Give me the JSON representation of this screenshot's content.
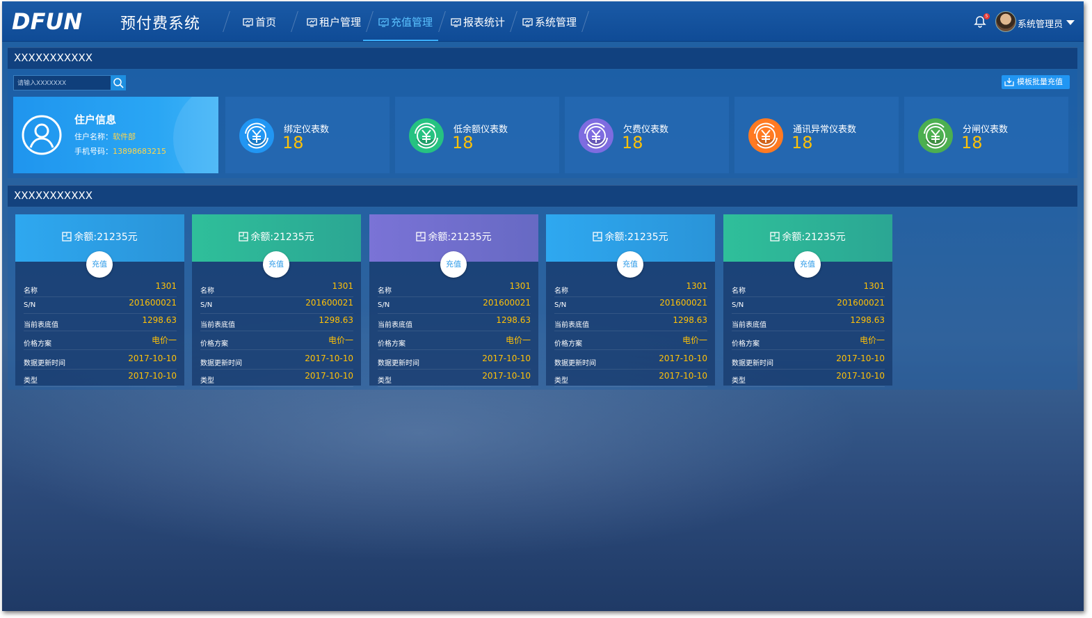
{
  "header": {
    "logo_text": "DFUN",
    "system_title": "预付费系统",
    "nav": [
      {
        "label": "首页"
      },
      {
        "label": "租户管理"
      },
      {
        "label": "充值管理"
      },
      {
        "label": "报表统计"
      },
      {
        "label": "系统管理"
      }
    ],
    "active_nav": "充值管理",
    "notification_count": "5",
    "user_name": "系统管理员"
  },
  "section1": {
    "title": "XXXXXXXXXXX",
    "search_placeholder": "请输入XXXXXXX",
    "batch_button": "模板批量充值",
    "tenant": {
      "title": "住户信息",
      "name_label": "住户名称：",
      "name_value": "软件部",
      "phone_label": "手机号码：",
      "phone_value": "13898683215"
    },
    "stats": [
      {
        "label": "绑定仪表数",
        "value": "18",
        "color": "#2196f3"
      },
      {
        "label": "低余额仪表数",
        "value": "18",
        "color": "#26c281"
      },
      {
        "label": "欠费仪表数",
        "value": "18",
        "color": "#7e6ce0"
      },
      {
        "label": "通讯异常仪表数",
        "value": "18",
        "color": "#ff7a22"
      },
      {
        "label": "分闸仪表数",
        "value": "18",
        "color": "#4caf50"
      }
    ]
  },
  "section2": {
    "title": "XXXXXXXXXXX",
    "meters": [
      {
        "balance": "余额:21235元",
        "recharge": "充值",
        "head_color": "#2ea8f0",
        "rows": [
          [
            "名称",
            "1301"
          ],
          [
            "S/N",
            "201600021"
          ],
          [
            "当前表底值",
            "1298.63"
          ],
          [
            "价格方案",
            "电价一"
          ],
          [
            "数据更新时间",
            "2017-10-10"
          ],
          [
            "类型",
            "2017-10-10"
          ]
        ]
      },
      {
        "balance": "余额:21235元",
        "recharge": "充值",
        "head_color": "#2fbf9a",
        "rows": [
          [
            "名称",
            "1301"
          ],
          [
            "S/N",
            "201600021"
          ],
          [
            "当前表底值",
            "1298.63"
          ],
          [
            "价格方案",
            "电价一"
          ],
          [
            "数据更新时间",
            "2017-10-10"
          ],
          [
            "类型",
            "2017-10-10"
          ]
        ]
      },
      {
        "balance": "余额:21235元",
        "recharge": "充值",
        "head_color": "#7a73d6",
        "rows": [
          [
            "名称",
            "1301"
          ],
          [
            "S/N",
            "201600021"
          ],
          [
            "当前表底值",
            "1298.63"
          ],
          [
            "价格方案",
            "电价一"
          ],
          [
            "数据更新时间",
            "2017-10-10"
          ],
          [
            "类型",
            "2017-10-10"
          ]
        ]
      },
      {
        "balance": "余额:21235元",
        "recharge": "充值",
        "head_color": "#2ea8f0",
        "rows": [
          [
            "名称",
            "1301"
          ],
          [
            "S/N",
            "201600021"
          ],
          [
            "当前表底值",
            "1298.63"
          ],
          [
            "价格方案",
            "电价一"
          ],
          [
            "数据更新时间",
            "2017-10-10"
          ],
          [
            "类型",
            "2017-10-10"
          ]
        ]
      },
      {
        "balance": "余额:21235元",
        "recharge": "充值",
        "head_color": "#2fbf9a",
        "rows": [
          [
            "名称",
            "1301"
          ],
          [
            "S/N",
            "201600021"
          ],
          [
            "当前表底值",
            "1298.63"
          ],
          [
            "价格方案",
            "电价一"
          ],
          [
            "数据更新时间",
            "2017-10-10"
          ],
          [
            "类型",
            "2017-10-10"
          ]
        ]
      }
    ]
  }
}
